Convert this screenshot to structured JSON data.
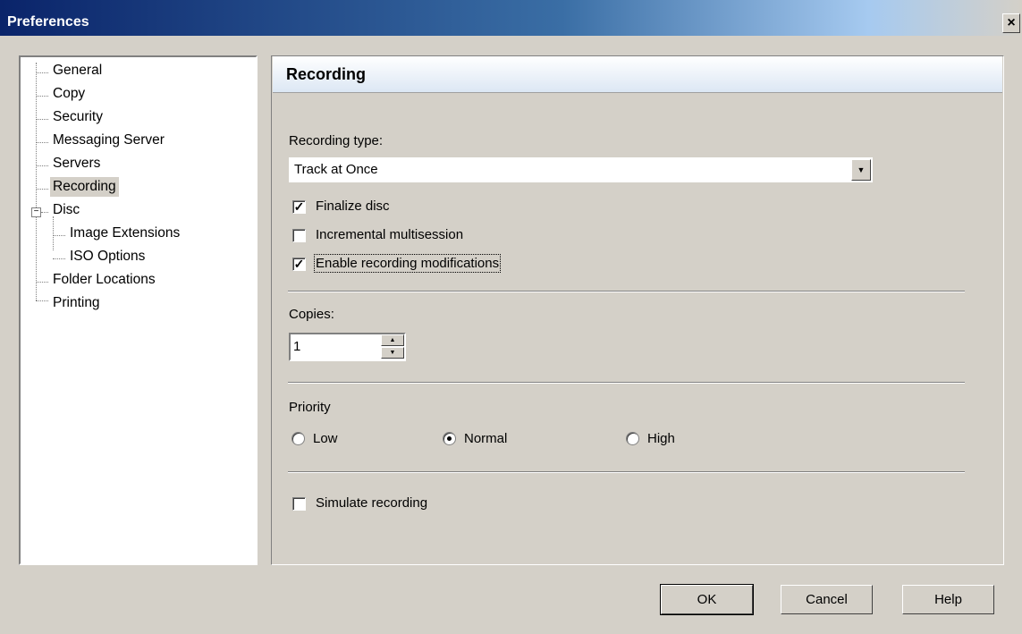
{
  "window": {
    "title": "Preferences",
    "close_glyph": "×"
  },
  "tree": {
    "items": [
      {
        "label": "General"
      },
      {
        "label": "Copy"
      },
      {
        "label": "Security"
      },
      {
        "label": "Messaging Server"
      },
      {
        "label": "Servers"
      },
      {
        "label": "Recording",
        "selected": true
      },
      {
        "label": "Disc",
        "expanded": true
      },
      {
        "label": "Image Extensions"
      },
      {
        "label": "ISO Options"
      },
      {
        "label": "Folder Locations"
      },
      {
        "label": "Printing"
      }
    ],
    "expander_glyph": "−"
  },
  "panel": {
    "title": "Recording",
    "recording_type_label": "Recording type:",
    "recording_type_value": "Track at Once",
    "combo_arrow": "▼",
    "options": [
      {
        "label": "Finalize disc",
        "checked": true
      },
      {
        "label": "Incremental multisession",
        "checked": false
      },
      {
        "label": "Enable recording modifications",
        "checked": true
      }
    ],
    "copies_label": "Copies:",
    "copies_value": "1",
    "spin_up": "▲",
    "spin_down": "▼",
    "priority_label": "Priority",
    "priority_options": [
      {
        "label": "Low",
        "selected": false
      },
      {
        "label": "Normal",
        "selected": true
      },
      {
        "label": "High",
        "selected": false
      }
    ],
    "simulate_label": "Simulate recording",
    "simulate_checked": false,
    "check_glyph": "✓"
  },
  "buttons": {
    "ok": "OK",
    "cancel": "Cancel",
    "help": "Help"
  }
}
